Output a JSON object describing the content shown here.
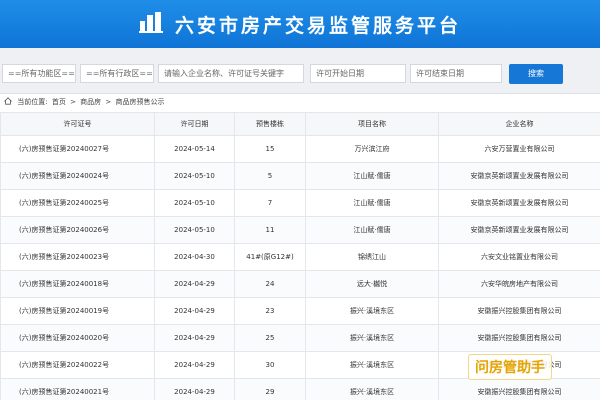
{
  "header": {
    "title": "六安市房产交易监管服务平台"
  },
  "filters": {
    "area_select": "==所有功能区==",
    "district_select": "==所有行政区==",
    "keyword_placeholder": "请输入企业名称、许可证号关键字",
    "start_date_placeholder": "许可开始日期",
    "end_date_placeholder": "许可结束日期",
    "search_label": "搜索"
  },
  "breadcrumb": {
    "prefix": "当前位置:",
    "items": [
      "首页",
      "商品房",
      "商品房预售公示"
    ],
    "separator": ">"
  },
  "table": {
    "columns": [
      "许可证号",
      "许可日期",
      "预售楼栋",
      "项目名称",
      "企业名称"
    ],
    "rows": [
      [
        "(六)房预售证第20240027号",
        "2024-05-14",
        "15",
        "万兴滨江府",
        "六安万营置业有限公司"
      ],
      [
        "(六)房预售证第20240024号",
        "2024-05-10",
        "5",
        "江山赋·儒唐",
        "安徽京英新颂置业发展有限公司"
      ],
      [
        "(六)房预售证第20240025号",
        "2024-05-10",
        "7",
        "江山赋·儒唐",
        "安徽京英新颂置业发展有限公司"
      ],
      [
        "(六)房预售证第20240026号",
        "2024-05-10",
        "11",
        "江山赋·儒唐",
        "安徽京英新颂置业发展有限公司"
      ],
      [
        "(六)房预售证第20240023号",
        "2024-04-30",
        "41#(原G12#)",
        "锦绣江山",
        "六安文业铭置业有限公司"
      ],
      [
        "(六)房预售证第20240018号",
        "2024-04-29",
        "24",
        "远大·樾悦",
        "六安华皖房地产有限公司"
      ],
      [
        "(六)房预售证第20240019号",
        "2024-04-29",
        "23",
        "振兴·溪境东区",
        "安徽振兴控股集团有限公司"
      ],
      [
        "(六)房预售证第20240020号",
        "2024-04-29",
        "25",
        "振兴·溪境东区",
        "安徽振兴控股集团有限公司"
      ],
      [
        "(六)房预售证第20240022号",
        "2024-04-29",
        "30",
        "振兴·溪境东区",
        "安徽振兴控股集团有限公司"
      ],
      [
        "(六)房预售证第20240021号",
        "2024-04-29",
        "29",
        "振兴·溪境东区",
        "安徽振兴控股集团有限公司"
      ]
    ]
  },
  "watermark": "问房管助手",
  "colors": {
    "header_blue": "#0f74d6",
    "button_blue": "#1677d6",
    "watermark_gold": "#e6a400"
  }
}
